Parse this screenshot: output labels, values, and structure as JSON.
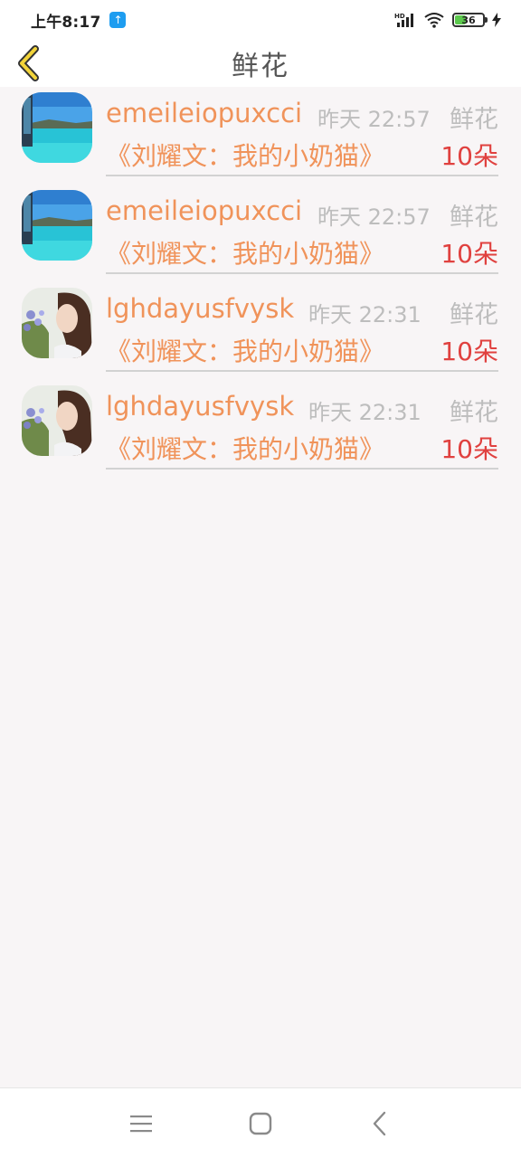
{
  "status_bar": {
    "time": "上午8:17",
    "badge_icon": "upload-icon",
    "battery_level": "36",
    "icons": [
      "hd-signal-icon",
      "wifi-icon",
      "battery-icon",
      "charging-icon"
    ]
  },
  "header": {
    "title": "鲜花",
    "back_icon": "chevron-left-icon"
  },
  "records": [
    {
      "username": "emeileiopuxcci",
      "time": "昨天 22:57",
      "gift_type": "鲜花",
      "book_title": "《刘耀文：我的小奶猫》",
      "count": "10朵",
      "avatar": "seaside-pool-avatar"
    },
    {
      "username": "emeileiopuxcci",
      "time": "昨天 22:57",
      "gift_type": "鲜花",
      "book_title": "《刘耀文：我的小奶猫》",
      "count": "10朵",
      "avatar": "seaside-pool-avatar"
    },
    {
      "username": "lghdayusfvysk",
      "time": "昨天 22:31",
      "gift_type": "鲜花",
      "book_title": "《刘耀文：我的小奶猫》",
      "count": "10朵",
      "avatar": "girl-with-flowers-avatar"
    },
    {
      "username": "lghdayusfvysk",
      "time": "昨天 22:31",
      "gift_type": "鲜花",
      "book_title": "《刘耀文：我的小奶猫》",
      "count": "10朵",
      "avatar": "girl-with-flowers-avatar"
    }
  ],
  "colors": {
    "accent_orange": "#f0935a",
    "count_red": "#e0413f",
    "muted_gray": "#bdbdbd",
    "back_icon_yellow": "#f2d43a"
  },
  "nav_bar": {
    "buttons": [
      "menu-icon",
      "home-square-icon",
      "back-arrow-icon"
    ]
  }
}
